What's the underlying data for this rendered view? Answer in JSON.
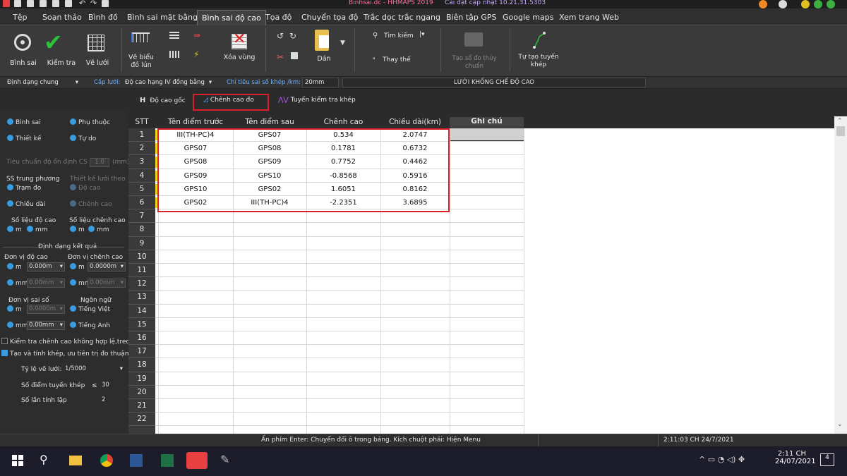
{
  "window": {
    "title": "Binhsai.dc - HHMAPS  2019",
    "update_text": "Cài đặt cập nhật 10.21.31.5303"
  },
  "menu": [
    "Tệp",
    "Soạn thảo",
    "Bình đồ",
    "Bình sai mặt bằng",
    "Bình sai độ cao",
    "Tọa độ",
    "Chuyển tọa độ",
    "Trắc dọc trắc ngang",
    "Biên tập GPS",
    "Google maps",
    "Xem trang Web"
  ],
  "ribbon": {
    "binh_sai": "Bình sai",
    "kiem_tra": "Kiểm tra",
    "ve_luoi": "Vẽ lưới",
    "ve_bieu_do_lun_1": "Vẽ biểu",
    "ve_bieu_do_lun_2": "đồ lún",
    "xoa_vung": "Xóa vùng",
    "dan": "Dán",
    "tim_kiem": "Tìm kiếm",
    "thay_the": "Thay thế",
    "tao_so_do_1": "Tạo sổ đo thủy",
    "tao_so_do_2": "chuẩn",
    "tu_tao_1": "Tự tạo tuyến",
    "tu_tao_2": "khép"
  },
  "optbar": {
    "dinh_dang": "Định dạng chung",
    "cap_luoi_label": "Cấp lưới:",
    "cap_luoi_value": "Độ cao hạng IV đồng bằng",
    "chi_tieu_label": "Chỉ tiêu sai số khép /km:",
    "chi_tieu_value": "20mm",
    "luoi_title": "LƯỚI KHỐNG CHẾ ĐỘ CAO"
  },
  "subtabs": {
    "do_cao_goc_icon": "H",
    "do_cao_goc": "Độ cao gốc",
    "chenh_cao_do": "Chênh cao đo",
    "tuyen_kiem_tra": "Tuyến kiểm tra khép"
  },
  "left": {
    "binh_sai": "Bình sai",
    "phu_thuoc": "Phụ thuộc",
    "thiet_ke": "Thiết kế",
    "tu_do": "Tự do",
    "tieu_chuan": "Tiêu chuẩn độ ổn định CS",
    "tieu_chuan_val": "1.0",
    "tieu_chuan_unit": "(mm)",
    "ss_trung_phuong": "SS trung phương",
    "thiet_ke_luoi": "Thiết kế lưới theo",
    "tram_do": "Trạm đo",
    "do_cao": "Độ cao",
    "chieu_dai": "Chiều dài",
    "chenh_cao": "Chênh cao",
    "so_lieu_do_cao": "Số liệu độ cao",
    "so_lieu_chenh_cao": "Số liệu chênh cao",
    "m": "m",
    "mm": "mm",
    "dinh_dang_kq": "Định dạng kết quả",
    "don_vi_do_cao": "Đơn vị độ cao",
    "don_vi_chenh_cao": "Đơn vị chênh cao",
    "dv1_m": "0.000m",
    "dv1_mm": "0.00mm",
    "dv2_m": "0.0000m",
    "dv2_mm": "0.00mm",
    "don_vi_sai_so": "Đơn vị sai số",
    "ngon_ngu": "Ngôn ngữ",
    "ss_m": "0.0000m",
    "ss_mm": "0.00mm",
    "tieng_viet": "Tiếng Việt",
    "tieng_anh": "Tiếng Anh",
    "kiem_tra_chk": "Kiểm tra chênh cao không hợp lệ,treo",
    "tao_tinh_khep": "Tạo và tính khép, ưu tiên trị đo thuận",
    "ty_le": "Tỷ lệ vẽ lưới:",
    "ty_le_val": "1/5000",
    "so_diem": "Số điểm  tuyến khép",
    "le": "≤",
    "so_diem_val": "30",
    "so_lan": "Số lần tính lặp",
    "so_lan_val": "2"
  },
  "table": {
    "headers": [
      "STT",
      "Tên điểm trước",
      "Tên điểm sau",
      "Chênh cao",
      "Chiều dài(km)",
      "Ghi chú"
    ],
    "rows": [
      [
        "1",
        "III(TH-PC)4",
        "GPS07",
        "0.534",
        "2.0747",
        ""
      ],
      [
        "2",
        "GPS07",
        "GPS08",
        "0.1781",
        "0.6732",
        ""
      ],
      [
        "3",
        "GPS08",
        "GPS09",
        "0.7752",
        "0.4462",
        ""
      ],
      [
        "4",
        "GPS09",
        "GPS10",
        "-0.8568",
        "0.5916",
        ""
      ],
      [
        "5",
        "GPS10",
        "GPS02",
        "1.6051",
        "0.8162",
        ""
      ],
      [
        "6",
        "GPS02",
        "III(TH-PC)4",
        "-2.2351",
        "3.6895",
        ""
      ]
    ],
    "empty_rows": [
      "7",
      "8",
      "9",
      "10",
      "11",
      "12",
      "13",
      "14",
      "15",
      "16",
      "17",
      "18",
      "19",
      "20",
      "21",
      "22"
    ]
  },
  "status": {
    "hint": "Ấn phím Enter: Chuyển đổi ô trong bảng. Kích chuột phải: Hiện Menu",
    "datetime": "2:11:03 CH 24/7/2021"
  },
  "taskbar": {
    "time": "2:11 CH",
    "date": "24/07/2021",
    "notif": "4"
  }
}
